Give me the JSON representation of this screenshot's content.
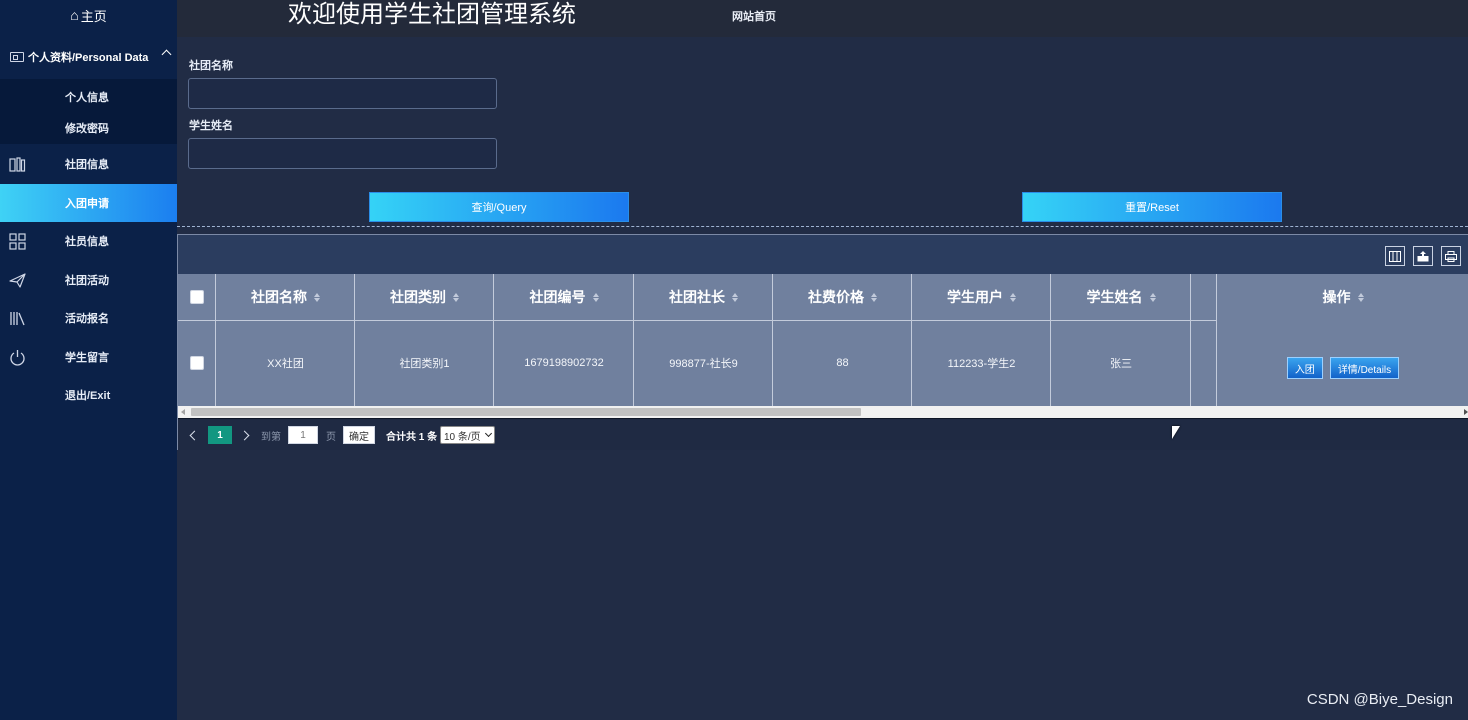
{
  "sidebar": {
    "home": {
      "icon": "home-icon",
      "label": "主页"
    },
    "group": {
      "icon": "id-card-icon",
      "label": "个人资料/Personal Data",
      "items": [
        {
          "label": "个人信息"
        },
        {
          "label": "修改密码"
        }
      ]
    },
    "items": [
      {
        "icon": "book-icon",
        "label": "社团信息",
        "active": false
      },
      {
        "icon": "",
        "label": "入团申请",
        "active": true
      },
      {
        "icon": "grid-icon",
        "label": "社员信息",
        "active": false
      },
      {
        "icon": "paper-plane-icon",
        "label": "社团活动",
        "active": false
      },
      {
        "icon": "library-icon",
        "label": "活动报名",
        "active": false
      },
      {
        "icon": "power-icon",
        "label": "学生留言",
        "active": false
      },
      {
        "icon": "",
        "label": "退出/Exit",
        "active": false
      }
    ]
  },
  "header": {
    "title": "欢迎使用学生社团管理系统",
    "home_link": "网站首页"
  },
  "search": {
    "club_name_label": "社团名称",
    "club_name_value": "",
    "student_name_label": "学生姓名",
    "student_name_value": "",
    "query_button": "查询/Query",
    "reset_button": "重置/Reset"
  },
  "toolbar": {
    "icons": [
      "columns-icon",
      "export-icon",
      "print-icon"
    ]
  },
  "table": {
    "headers": [
      "社团名称",
      "社团类别",
      "社团编号",
      "社团社长",
      "社费价格",
      "学生用户",
      "学生姓名",
      "",
      "操作"
    ],
    "rows": [
      {
        "cells": [
          "XX社团",
          "社团类别1",
          "1679198902732",
          "998877-社长9",
          "88",
          "112233-学生2",
          "张三",
          ""
        ],
        "actions": [
          "入团",
          "详情/Details"
        ]
      }
    ]
  },
  "pager": {
    "current_page": "1",
    "goto_label": "到第",
    "goto_value": "1",
    "page_label": "页",
    "confirm_button": "确定",
    "total_text": "合计共 1 条",
    "page_size": "10 条/页"
  },
  "colors": {
    "sidebar_bg": "#0b2148",
    "content_bg": "#212c45",
    "accent_from": "#35d3f6",
    "accent_to": "#1b79ef",
    "page_active": "#129781"
  },
  "watermark": "CSDN @Biye_Design"
}
